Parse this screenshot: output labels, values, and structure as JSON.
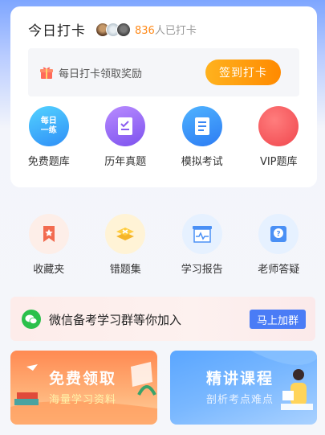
{
  "checkin": {
    "title": "今日打卡",
    "count": "836",
    "count_suffix": "人已打卡",
    "reward_text": "每日打卡领取奖励",
    "button_label": "签到打卡"
  },
  "main_grid": [
    {
      "label": "免费题库",
      "icon": "free-question-bank-icon",
      "badge": [
        "每日",
        "一练"
      ]
    },
    {
      "label": "历年真题",
      "icon": "checklist-icon"
    },
    {
      "label": "模拟考试",
      "icon": "document-icon"
    },
    {
      "label": "VIP题库",
      "icon": "vip-icon"
    }
  ],
  "tools_grid": [
    {
      "label": "收藏夹",
      "icon": "bookmark-star-icon"
    },
    {
      "label": "错题集",
      "icon": "layers-x-icon"
    },
    {
      "label": "学习报告",
      "icon": "report-chart-icon"
    },
    {
      "label": "老师答疑",
      "icon": "question-icon"
    }
  ],
  "wechat": {
    "text": "微信备考学习群等你加入",
    "button_label": "马上加群"
  },
  "banners": [
    {
      "title": "免费领取",
      "subtitle": "海量学习资料"
    },
    {
      "title": "精讲课程",
      "subtitle": "剖析考点难点"
    }
  ],
  "colors": {
    "accent_orange": "#ff8a00",
    "accent_blue": "#4a7cf6",
    "wechat_green": "#2bc04b"
  }
}
